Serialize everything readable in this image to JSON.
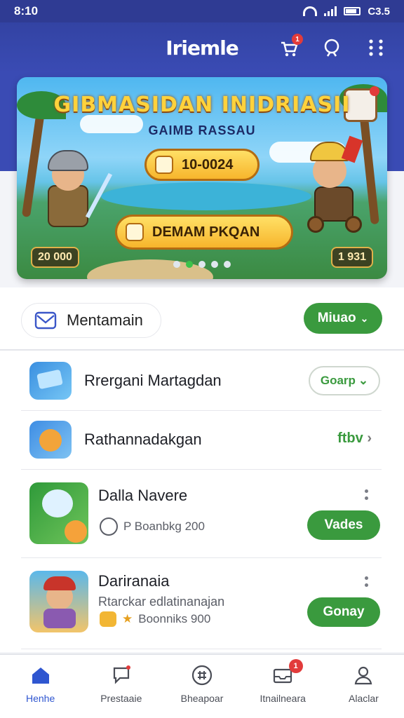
{
  "status_bar": {
    "time": "8:10",
    "battery_label": "C3.5"
  },
  "app_bar": {
    "brand": "Iriemle",
    "cart_badge": "1"
  },
  "banner": {
    "title": "GIBMASIDAN INIDRIASII",
    "subtitle": "GAIMB RASSAU",
    "pill_top": "10-0024",
    "pill_cta": "DEMAM PKQAN",
    "score_left": "20 000",
    "score_right": "1 931",
    "carousel_count": 5,
    "carousel_active": 1
  },
  "filter": {
    "chip_label": "Mentamain",
    "more_button": "Miuao"
  },
  "list": [
    {
      "title": "Rrergani Martagdan",
      "action": "Goarp"
    },
    {
      "title": "Rathannadakgan",
      "action": "ftbv"
    },
    {
      "title": "Dalla Navere",
      "meta": "P Boanbkg 200",
      "action": "Vades"
    },
    {
      "title": "Dariranaia",
      "subtitle": "Rtarckar edlatinanajan",
      "meta": "Boonniks 900",
      "action": "Gonay"
    }
  ],
  "bottom_nav": [
    {
      "label": "Henhe",
      "icon": "home-icon"
    },
    {
      "label": "Prestaaie",
      "icon": "chat-icon"
    },
    {
      "label": "Bheapoar",
      "icon": "grid-icon"
    },
    {
      "label": "Itnailneara",
      "icon": "inbox-icon",
      "badge": "1"
    },
    {
      "label": "Alaclar",
      "icon": "profile-icon"
    }
  ],
  "colors": {
    "primary": "#3343a3",
    "accent_green": "#3a9a3e",
    "nav_active": "#2f56d0",
    "badge_red": "#e23b3b"
  }
}
